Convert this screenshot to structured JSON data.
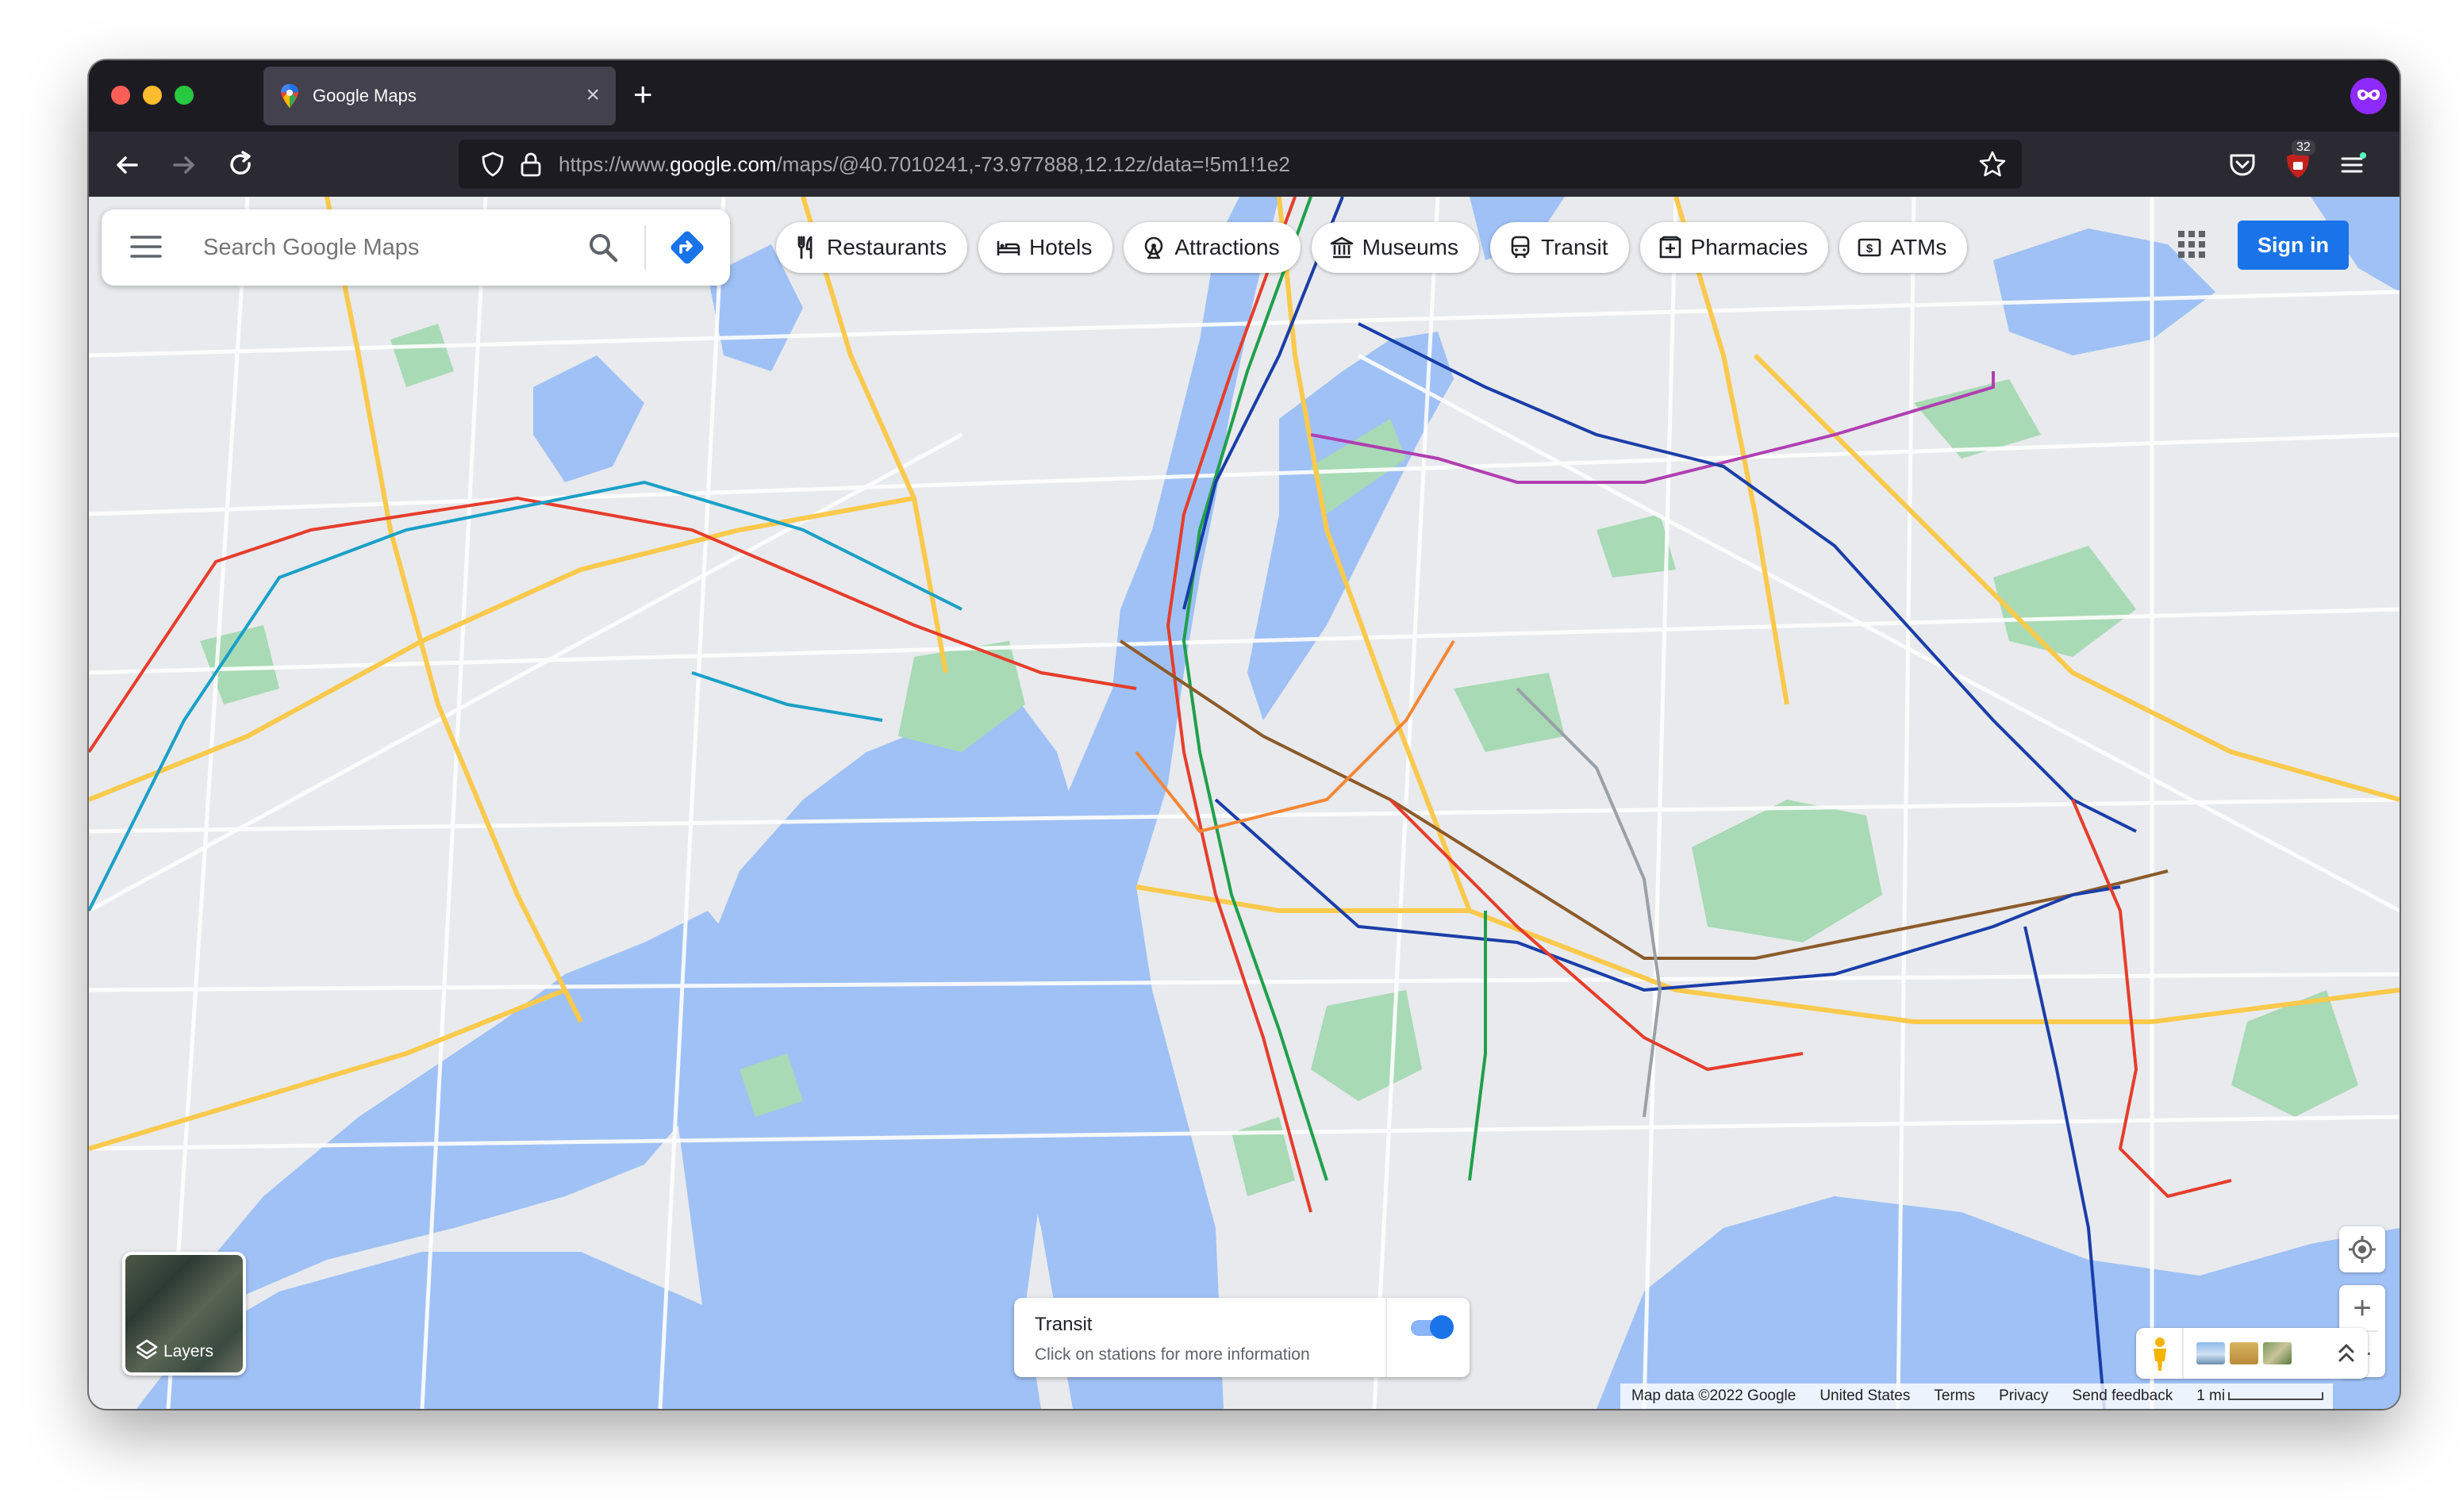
{
  "browser": {
    "tab_title": "Google Maps",
    "new_tab": "+",
    "tab_close": "×",
    "url_prefix": "https://www.",
    "url_host": "google.com",
    "url_path": "/maps/@40.7010241,-73.977888,12.12z/data=!5m1!1e2",
    "notification_count": "32"
  },
  "search": {
    "placeholder": "Search Google Maps"
  },
  "chips": [
    {
      "label": "Restaurants",
      "icon": "fork-knife-icon"
    },
    {
      "label": "Hotels",
      "icon": "bed-icon"
    },
    {
      "label": "Attractions",
      "icon": "ferris-wheel-icon"
    },
    {
      "label": "Museums",
      "icon": "museum-icon"
    },
    {
      "label": "Transit",
      "icon": "train-icon"
    },
    {
      "label": "Pharmacies",
      "icon": "pharmacy-icon"
    },
    {
      "label": "ATMs",
      "icon": "atm-icon"
    }
  ],
  "sign_in": "Sign in",
  "layers": {
    "label": "Layers"
  },
  "transit_panel": {
    "title": "Transit",
    "subtitle": "Click on stations for more information",
    "toggle_on": true
  },
  "zoom": {
    "in": "+",
    "out": "−"
  },
  "attribution": {
    "map_data": "Map data ©2022 Google",
    "region": "United States",
    "terms": "Terms",
    "privacy": "Privacy",
    "feedback": "Send feedback",
    "scale": "1 mi"
  },
  "colors": {
    "water": "#9fc1f5",
    "land": "#e8eaed",
    "park": "#a8dab5",
    "highway": "#fbc94c",
    "accent": "#1a73e8",
    "line_red": "#e63d2b",
    "line_green": "#1fa04a",
    "line_blue": "#1a3ea8",
    "line_purple": "#b03fb1",
    "line_brown": "#8c5a2a",
    "line_orange": "#f58634",
    "line_grey": "#9aa0a6",
    "line_teal": "#1aa0c8"
  }
}
